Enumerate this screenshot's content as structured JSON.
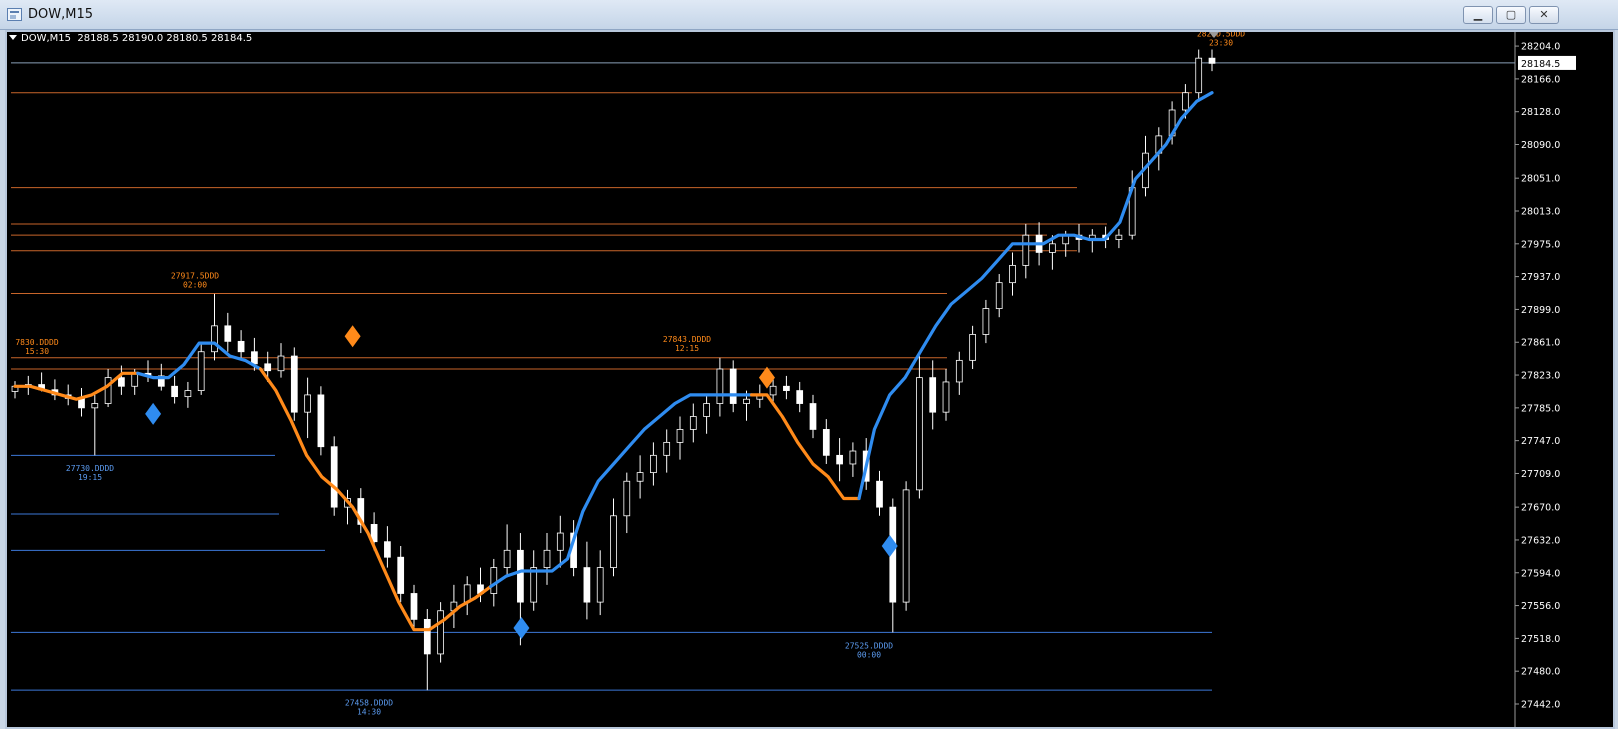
{
  "window": {
    "title": "DOW,M15",
    "buttons": {
      "minimize": "▁",
      "restore": "▢",
      "close": "✕"
    }
  },
  "chart": {
    "symbol_info": "DOW,M15  28188.5 28190.0 28180.5 28184.5",
    "current_price": "28184.5",
    "colors": {
      "background": "#000000",
      "candles": "#ffffff",
      "trend_up": "#2f8cf0",
      "trend_down": "#ff8a1a",
      "resistance": "#c8652a",
      "support": "#3d78d8",
      "price_line": "#8aa0b8",
      "axis_text": "#ffffff"
    },
    "icons": {
      "signal": "diamond-icon",
      "menu": "triangle-down-icon"
    }
  },
  "chart_data": {
    "type": "line",
    "y_axis_labels": [
      "28204.0",
      "28166.0",
      "28128.0",
      "28090.0",
      "28051.0",
      "28013.0",
      "27975.0",
      "27937.0",
      "27899.0",
      "27861.0",
      "27823.0",
      "27785.0",
      "27747.0",
      "27709.0",
      "27670.0",
      "27632.0",
      "27594.0",
      "27556.0",
      "27518.0",
      "27480.0",
      "27442.0"
    ],
    "ylim": [
      27442,
      28204
    ],
    "annotations": [
      {
        "price": "7830.DDDD",
        "time": "15:30",
        "kind": "high"
      },
      {
        "price": "27917.5DDD",
        "time": "02:00",
        "kind": "high"
      },
      {
        "price": "27843.DDDD",
        "time": "12:15",
        "kind": "high"
      },
      {
        "price": "282DD.5DDD",
        "time": "23:30",
        "kind": "high"
      },
      {
        "price": "27730.DDDD",
        "time": "19:15",
        "kind": "low"
      },
      {
        "price": "27458.DDDD",
        "time": "14:30",
        "kind": "low"
      },
      {
        "price": "27525.DDDD",
        "time": "00:00",
        "kind": "low"
      }
    ],
    "resistance_levels": [
      28150,
      28040,
      27998,
      27985,
      27967,
      27917.5,
      27843,
      27830
    ],
    "support_levels": [
      27730,
      27662,
      27620,
      27525,
      27458
    ],
    "series": [
      {
        "values": [
          27810,
          27810,
          27805,
          27800,
          27795,
          27800,
          27810,
          27825,
          27825,
          27820,
          27820,
          27835,
          27860,
          27860,
          27845,
          27840,
          27830,
          27805,
          27770,
          27730,
          27705,
          27690,
          27670,
          27640,
          27600,
          27560,
          27528,
          27528,
          27540,
          27555,
          27565,
          27578,
          27590,
          27596,
          27596,
          27596,
          27610,
          27665,
          27700,
          27720,
          27740,
          27760,
          27775,
          27790,
          27800,
          27800,
          27800,
          27800,
          27800,
          27800,
          27775,
          27745,
          27720,
          27705,
          27680,
          27680,
          27760,
          27800,
          27820,
          27850,
          27880,
          27905,
          27920,
          27935,
          27955,
          27975,
          27975,
          27975,
          27985,
          27985,
          27980,
          27980,
          28000,
          28050,
          28070,
          28090,
          28120,
          28140,
          28150
        ]
      }
    ],
    "trend_color_ranges": [
      {
        "color": "down",
        "from": 0,
        "to": 8
      },
      {
        "color": "up",
        "from": 8,
        "to": 16
      },
      {
        "color": "down",
        "from": 16,
        "to": 31
      },
      {
        "color": "up",
        "from": 31,
        "to": 48
      },
      {
        "color": "down",
        "from": 48,
        "to": 55
      },
      {
        "color": "up",
        "from": 55,
        "to": 78
      }
    ],
    "signals": [
      {
        "index": 9,
        "price": 27778,
        "color": "up"
      },
      {
        "index": 22,
        "price": 27868,
        "color": "down"
      },
      {
        "index": 33,
        "price": 27530,
        "color": "up"
      },
      {
        "index": 49,
        "price": 27820,
        "color": "down"
      },
      {
        "index": 57,
        "price": 27625,
        "color": "up"
      }
    ],
    "candles": [
      {
        "o": 27804,
        "h": 27816,
        "l": 27796,
        "c": 27810
      },
      {
        "o": 27810,
        "h": 27822,
        "l": 27800,
        "c": 27812
      },
      {
        "o": 27812,
        "h": 27826,
        "l": 27804,
        "c": 27806
      },
      {
        "o": 27806,
        "h": 27818,
        "l": 27794,
        "c": 27800
      },
      {
        "o": 27800,
        "h": 27812,
        "l": 27788,
        "c": 27796
      },
      {
        "o": 27796,
        "h": 27808,
        "l": 27775,
        "c": 27785
      },
      {
        "o": 27785,
        "h": 27800,
        "l": 27730,
        "c": 27790
      },
      {
        "o": 27790,
        "h": 27830,
        "l": 27786,
        "c": 27820
      },
      {
        "o": 27820,
        "h": 27834,
        "l": 27800,
        "c": 27810
      },
      {
        "o": 27810,
        "h": 27830,
        "l": 27800,
        "c": 27825
      },
      {
        "o": 27825,
        "h": 27840,
        "l": 27815,
        "c": 27822
      },
      {
        "o": 27822,
        "h": 27836,
        "l": 27805,
        "c": 27810
      },
      {
        "o": 27810,
        "h": 27822,
        "l": 27790,
        "c": 27798
      },
      {
        "o": 27798,
        "h": 27815,
        "l": 27785,
        "c": 27805
      },
      {
        "o": 27805,
        "h": 27860,
        "l": 27800,
        "c": 27850
      },
      {
        "o": 27850,
        "h": 27917,
        "l": 27840,
        "c": 27880
      },
      {
        "o": 27880,
        "h": 27895,
        "l": 27850,
        "c": 27862
      },
      {
        "o": 27862,
        "h": 27875,
        "l": 27840,
        "c": 27850
      },
      {
        "o": 27850,
        "h": 27866,
        "l": 27828,
        "c": 27836
      },
      {
        "o": 27836,
        "h": 27850,
        "l": 27815,
        "c": 27828
      },
      {
        "o": 27828,
        "h": 27860,
        "l": 27820,
        "c": 27845
      },
      {
        "o": 27845,
        "h": 27855,
        "l": 27770,
        "c": 27780
      },
      {
        "o": 27780,
        "h": 27820,
        "l": 27750,
        "c": 27800
      },
      {
        "o": 27800,
        "h": 27810,
        "l": 27730,
        "c": 27740
      },
      {
        "o": 27740,
        "h": 27752,
        "l": 27660,
        "c": 27670
      },
      {
        "o": 27670,
        "h": 27690,
        "l": 27650,
        "c": 27680
      },
      {
        "o": 27680,
        "h": 27692,
        "l": 27640,
        "c": 27650
      },
      {
        "o": 27650,
        "h": 27664,
        "l": 27620,
        "c": 27630
      },
      {
        "o": 27630,
        "h": 27648,
        "l": 27600,
        "c": 27612
      },
      {
        "o": 27612,
        "h": 27625,
        "l": 27560,
        "c": 27570
      },
      {
        "o": 27570,
        "h": 27580,
        "l": 27530,
        "c": 27540
      },
      {
        "o": 27540,
        "h": 27552,
        "l": 27458,
        "c": 27500
      },
      {
        "o": 27500,
        "h": 27560,
        "l": 27490,
        "c": 27550
      },
      {
        "o": 27550,
        "h": 27580,
        "l": 27530,
        "c": 27560
      },
      {
        "o": 27560,
        "h": 27590,
        "l": 27545,
        "c": 27580
      },
      {
        "o": 27580,
        "h": 27600,
        "l": 27560,
        "c": 27570
      },
      {
        "o": 27570,
        "h": 27610,
        "l": 27555,
        "c": 27600
      },
      {
        "o": 27600,
        "h": 27650,
        "l": 27590,
        "c": 27620
      },
      {
        "o": 27620,
        "h": 27640,
        "l": 27510,
        "c": 27560
      },
      {
        "o": 27560,
        "h": 27620,
        "l": 27550,
        "c": 27600
      },
      {
        "o": 27600,
        "h": 27640,
        "l": 27580,
        "c": 27620
      },
      {
        "o": 27620,
        "h": 27660,
        "l": 27600,
        "c": 27640
      },
      {
        "o": 27640,
        "h": 27655,
        "l": 27590,
        "c": 27600
      },
      {
        "o": 27600,
        "h": 27630,
        "l": 27540,
        "c": 27560
      },
      {
        "o": 27560,
        "h": 27620,
        "l": 27545,
        "c": 27600
      },
      {
        "o": 27600,
        "h": 27680,
        "l": 27590,
        "c": 27660
      },
      {
        "o": 27660,
        "h": 27710,
        "l": 27640,
        "c": 27700
      },
      {
        "o": 27700,
        "h": 27730,
        "l": 27680,
        "c": 27710
      },
      {
        "o": 27710,
        "h": 27745,
        "l": 27695,
        "c": 27730
      },
      {
        "o": 27730,
        "h": 27760,
        "l": 27710,
        "c": 27745
      },
      {
        "o": 27745,
        "h": 27775,
        "l": 27725,
        "c": 27760
      },
      {
        "o": 27760,
        "h": 27790,
        "l": 27745,
        "c": 27775
      },
      {
        "o": 27775,
        "h": 27800,
        "l": 27755,
        "c": 27790
      },
      {
        "o": 27790,
        "h": 27843,
        "l": 27775,
        "c": 27830
      },
      {
        "o": 27830,
        "h": 27840,
        "l": 27780,
        "c": 27790
      },
      {
        "o": 27790,
        "h": 27805,
        "l": 27770,
        "c": 27795
      },
      {
        "o": 27795,
        "h": 27812,
        "l": 27785,
        "c": 27800
      },
      {
        "o": 27800,
        "h": 27820,
        "l": 27790,
        "c": 27810
      },
      {
        "o": 27810,
        "h": 27822,
        "l": 27795,
        "c": 27805
      },
      {
        "o": 27805,
        "h": 27815,
        "l": 27780,
        "c": 27790
      },
      {
        "o": 27790,
        "h": 27800,
        "l": 27750,
        "c": 27760
      },
      {
        "o": 27760,
        "h": 27772,
        "l": 27720,
        "c": 27730
      },
      {
        "o": 27730,
        "h": 27750,
        "l": 27700,
        "c": 27720
      },
      {
        "o": 27720,
        "h": 27745,
        "l": 27705,
        "c": 27735
      },
      {
        "o": 27735,
        "h": 27750,
        "l": 27690,
        "c": 27700
      },
      {
        "o": 27700,
        "h": 27712,
        "l": 27660,
        "c": 27670
      },
      {
        "o": 27670,
        "h": 27680,
        "l": 27525,
        "c": 27560
      },
      {
        "o": 27560,
        "h": 27700,
        "l": 27550,
        "c": 27690
      },
      {
        "o": 27690,
        "h": 27845,
        "l": 27680,
        "c": 27820
      },
      {
        "o": 27820,
        "h": 27840,
        "l": 27760,
        "c": 27780
      },
      {
        "o": 27780,
        "h": 27830,
        "l": 27770,
        "c": 27815
      },
      {
        "o": 27815,
        "h": 27850,
        "l": 27800,
        "c": 27840
      },
      {
        "o": 27840,
        "h": 27880,
        "l": 27830,
        "c": 27870
      },
      {
        "o": 27870,
        "h": 27910,
        "l": 27860,
        "c": 27900
      },
      {
        "o": 27900,
        "h": 27940,
        "l": 27890,
        "c": 27930
      },
      {
        "o": 27930,
        "h": 27965,
        "l": 27915,
        "c": 27950
      },
      {
        "o": 27950,
        "h": 27998,
        "l": 27935,
        "c": 27985
      },
      {
        "o": 27985,
        "h": 28000,
        "l": 27950,
        "c": 27965
      },
      {
        "o": 27965,
        "h": 27985,
        "l": 27945,
        "c": 27975
      },
      {
        "o": 27975,
        "h": 27990,
        "l": 27960,
        "c": 27985
      },
      {
        "o": 27985,
        "h": 27998,
        "l": 27965,
        "c": 27980
      },
      {
        "o": 27980,
        "h": 27992,
        "l": 27965,
        "c": 27985
      },
      {
        "o": 27985,
        "h": 27995,
        "l": 27970,
        "c": 27980
      },
      {
        "o": 27980,
        "h": 27992,
        "l": 27970,
        "c": 27985
      },
      {
        "o": 27985,
        "h": 28060,
        "l": 27980,
        "c": 28040
      },
      {
        "o": 28040,
        "h": 28100,
        "l": 28030,
        "c": 28080
      },
      {
        "o": 28080,
        "h": 28110,
        "l": 28060,
        "c": 28100
      },
      {
        "o": 28100,
        "h": 28140,
        "l": 28090,
        "c": 28130
      },
      {
        "o": 28130,
        "h": 28160,
        "l": 28120,
        "c": 28150
      },
      {
        "o": 28150,
        "h": 28200,
        "l": 28140,
        "c": 28190
      },
      {
        "o": 28190,
        "h": 28200,
        "l": 28175,
        "c": 28184
      }
    ]
  }
}
